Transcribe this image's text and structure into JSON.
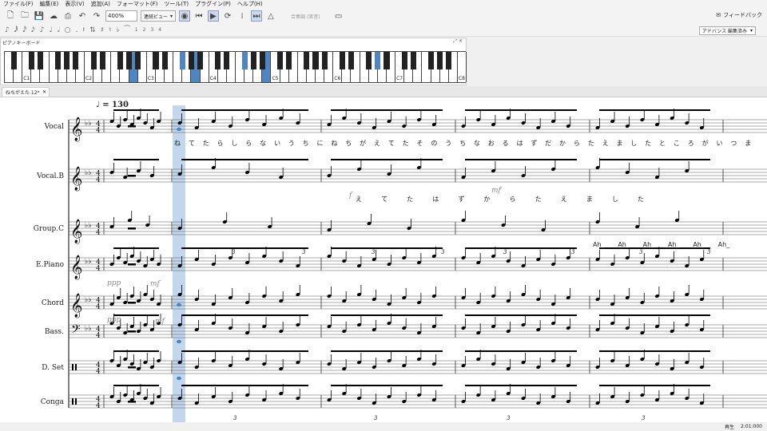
{
  "menu": [
    "ファイル(F)",
    "編集(E)",
    "表示(V)",
    "追加(A)",
    "フォーマット(F)",
    "ツール(T)",
    "プラグイン(P)",
    "ヘルプ(H)"
  ],
  "toolbar": {
    "zoom": "400%",
    "view_mode": "連続ビュー",
    "concert_pitch": "合奏調 (実音)",
    "feedback": "フィードバック"
  },
  "toolbar2": {
    "voices": [
      "1",
      "2",
      "3",
      "4"
    ],
    "workspace": "アドバンス 編集済み"
  },
  "piano": {
    "title": "ピアノキーボード",
    "labels": [
      "C1",
      "C2",
      "C3",
      "C4",
      "C5",
      "C6",
      "C7",
      "C8"
    ]
  },
  "tab": {
    "label": "ねちがえた.12*"
  },
  "score": {
    "tempo": "♩ = 130",
    "instruments": [
      "Vocal",
      "Vocal.B",
      "Group.C",
      "E.Piano",
      "Chord",
      "Bass.",
      "D. Set",
      "Conga"
    ],
    "lyrics": {
      "vocal": [
        "ね",
        "て",
        "た",
        "ら",
        "し",
        "ら",
        "な",
        "い",
        "う",
        "ち",
        "に",
        "ね",
        "ち",
        "が",
        "え",
        "て",
        "た",
        "そ",
        "の",
        "う",
        "ち",
        "な",
        "お",
        "る",
        "は",
        "ず",
        "だ",
        "か",
        "ら",
        "た",
        "え",
        "ま",
        "し",
        "た",
        "と",
        "こ",
        "ろ",
        "が",
        "い",
        "つ",
        "ま"
      ],
      "vocal_b": [
        "え",
        "て",
        "た",
        "は",
        "ず",
        "か",
        "ら",
        "た",
        "え",
        "ま",
        "し",
        "た"
      ],
      "group_c": [
        "Ah_",
        "Ah_",
        "Ah_",
        "Ah_",
        "Ah_",
        "Ah_"
      ]
    },
    "dynamics": {
      "f": "f",
      "mf": "mf",
      "ppp": "ppp"
    },
    "tuplet": "3"
  },
  "status": {
    "mode": "再生",
    "time": "2:01:000"
  },
  "colors": {
    "highlight": "#4f86c2",
    "selection": "#b7d0ea"
  }
}
